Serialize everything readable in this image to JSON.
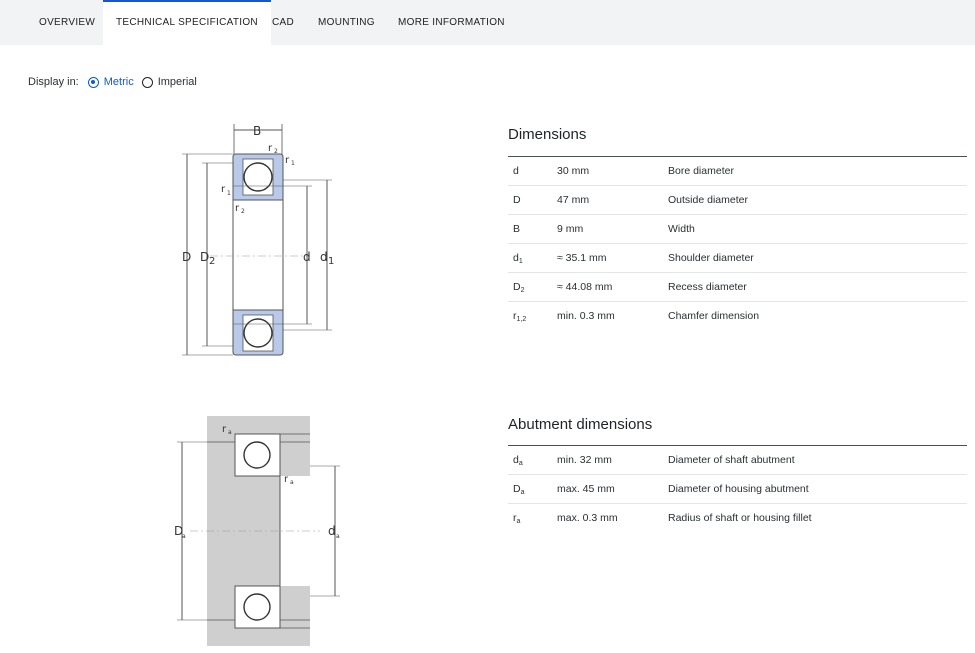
{
  "tabs": [
    {
      "label": "OVERVIEW",
      "active": false
    },
    {
      "label": "TECHNICAL SPECIFICATION",
      "active": true
    },
    {
      "label": "CAD",
      "active": false
    },
    {
      "label": "MOUNTING",
      "active": false
    },
    {
      "label": "MORE INFORMATION",
      "active": false
    }
  ],
  "display": {
    "label": "Display in:",
    "options": [
      {
        "label": "Metric",
        "selected": true
      },
      {
        "label": "Imperial",
        "selected": false
      }
    ]
  },
  "dimensions": {
    "title": "Dimensions",
    "rows": [
      {
        "sym": "d",
        "sub": "",
        "value": "30 mm",
        "desc": "Bore diameter"
      },
      {
        "sym": "D",
        "sub": "",
        "value": "47 mm",
        "desc": "Outside diameter"
      },
      {
        "sym": "B",
        "sub": "",
        "value": "9 mm",
        "desc": "Width"
      },
      {
        "sym": "d",
        "sub": "1",
        "value": "≈ 35.1 mm",
        "desc": "Shoulder diameter"
      },
      {
        "sym": "D",
        "sub": "2",
        "value": "≈ 44.08 mm",
        "desc": "Recess diameter"
      },
      {
        "sym": "r",
        "sub": "1,2",
        "value": "min. 0.3 mm",
        "desc": "Chamfer dimension"
      }
    ]
  },
  "abutment": {
    "title": "Abutment dimensions",
    "rows": [
      {
        "sym": "d",
        "sub": "a",
        "value": "min. 32 mm",
        "desc": "Diameter of shaft abutment"
      },
      {
        "sym": "D",
        "sub": "a",
        "value": "max. 45 mm",
        "desc": "Diameter of housing abutment"
      },
      {
        "sym": "r",
        "sub": "a",
        "value": "max. 0.3 mm",
        "desc": "Radius of shaft or housing fillet"
      }
    ]
  },
  "diagram1": {
    "labels": {
      "B": "B",
      "r": "r",
      "D": "D",
      "d": "d",
      "one": "1",
      "two": "2"
    },
    "colors": {
      "seal": "#b9c9ea",
      "line": "#555555"
    }
  },
  "diagram2": {
    "labels": {
      "r": "r",
      "D": "D",
      "d": "d",
      "a": "a"
    },
    "colors": {
      "housing": "#cfcfcf",
      "line": "#555555"
    }
  }
}
